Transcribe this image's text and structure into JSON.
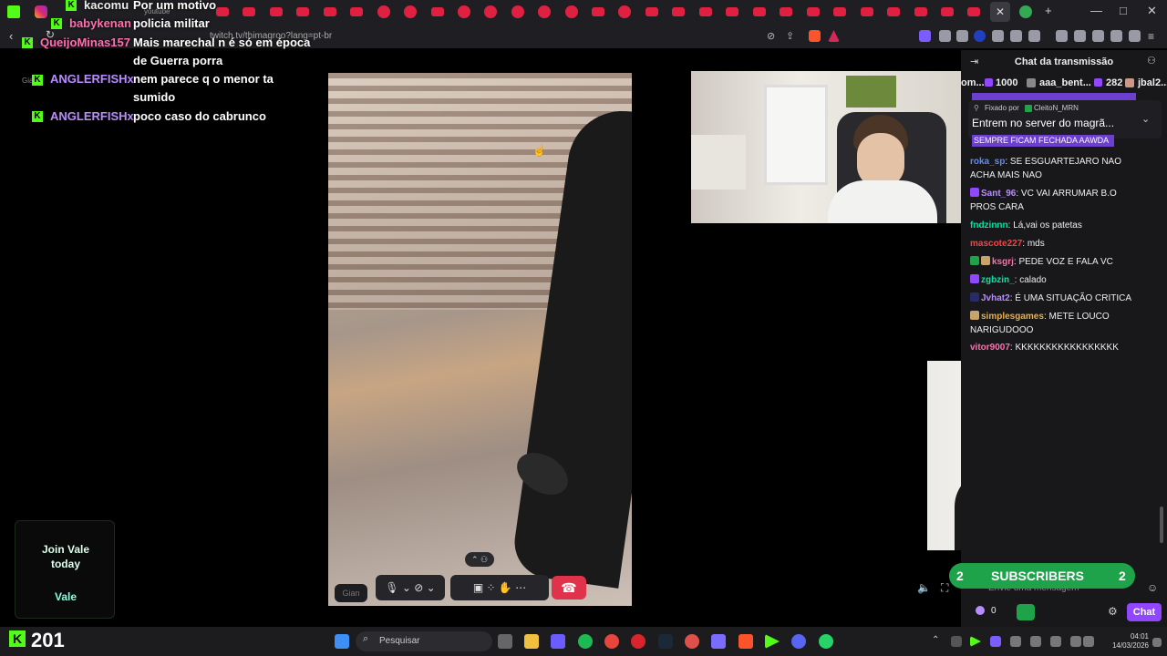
{
  "browser": {
    "url": "twitch.tv/thimagroo?lang=pt-br",
    "window_controls": [
      "—",
      "□",
      "✕"
    ]
  },
  "overlay_chat": [
    {
      "user": "kacomu",
      "text": "Por um motivo",
      "user_color": "#53fc18"
    },
    {
      "user": "babykenan",
      "text": "policia militar",
      "user_color": "#ff6fae"
    },
    {
      "user": "QueijoMinas157",
      "text": "Mais marechal n é só em época",
      "user_color": "#ff6fae"
    },
    {
      "user": "",
      "text": "de Guerra porra",
      "user_color": "#fff"
    },
    {
      "user": "ANGLERFISHx",
      "text": "nem parece q o menor ta",
      "user_color": "#b98cff"
    },
    {
      "user": "",
      "text": "sumido",
      "user_color": "#fff"
    },
    {
      "user": "ANGLERFISHx",
      "text": "poco caso do cabrunco",
      "user_color": "#b98cff"
    }
  ],
  "overlay_misc": {
    "youtube": "youtube",
    "gian": "Gian"
  },
  "call_controls": {
    "gian_label": "Gian"
  },
  "twitch": {
    "header_title": "Chat da transmissão",
    "gifts": [
      {
        "name": "om...",
        "count": "1000"
      },
      {
        "name": "aaa_bent...",
        "count": "282"
      },
      {
        "name": "jbal2...",
        "count": ""
      }
    ],
    "pinned_by": "Fixado por",
    "pinned_user": "CleitoN_MRN",
    "pinned_text": "Entrem no server do magrã...",
    "highlight_text": "SEMPRE FICAM FECHADA AAWDA",
    "messages": [
      {
        "user": "roka_sp",
        "color": "#5b8cff",
        "text": "SE ESGUARTEJARO NAO ACHA MAIS NAO"
      },
      {
        "user": "Sant_96",
        "color": "#b98cff",
        "text": "VC VAI ARRUMAR B.O PROS CARA"
      },
      {
        "user": "fndzinnn",
        "color": "#00e5a0",
        "text": "Lá,vai os patetas"
      },
      {
        "user": "mascote227",
        "color": "#ff4040",
        "text": "mds"
      },
      {
        "user": "ksgrj",
        "color": "#ff6fae",
        "text": "PEDE VOZ E FALA VC"
      },
      {
        "user": "zgbzin_",
        "color": "#00e5a0",
        "text": "calado"
      },
      {
        "user": "Jvhat2",
        "color": "#b98cff",
        "text": "É UMA SITUAÇÃO CRITICA"
      },
      {
        "user": "simplesgames",
        "color": "#e8b04a",
        "text": "METE LOUCO NARIGUDOOO"
      },
      {
        "user": "vitor9007",
        "color": "#ff6fae",
        "text": "KKKKKKKKKKKKKKKKK"
      }
    ],
    "input_placeholder": "Envie uma mensagem",
    "points": "0",
    "chat_button": "Chat"
  },
  "sub_banner": {
    "left": "2",
    "label": "SUBSCRIBERS",
    "right": "2"
  },
  "kick_promo": {
    "line1": "Join Vale",
    "line2": "today",
    "brand": "Vale"
  },
  "kick_count": "201",
  "taskbar": {
    "search_label": "Pesquisar",
    "time": "04:01",
    "date": "14/03/2026"
  }
}
